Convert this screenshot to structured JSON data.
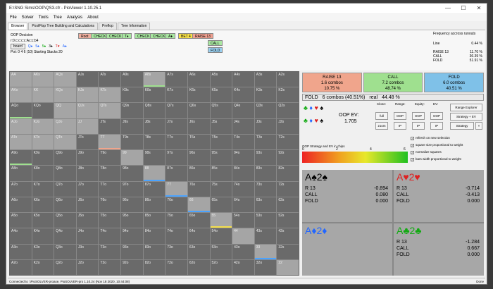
{
  "window": {
    "title": "E:\\SNG Sims\\OOP\\QS3.cfr - PioViewer 1.10.25.1",
    "min": "—",
    "max": "☐",
    "close": "✕"
  },
  "menu": [
    "File",
    "Solver",
    "Tools",
    "Tree",
    "Analysis",
    "About"
  ],
  "tabs": [
    "Browser",
    "PostFlop Tree Building and Calculations",
    "Preflop",
    "Tree Information"
  ],
  "oop": {
    "title": "OOP Decision",
    "hand_line": "r:0:c:c:c:c:Ac:c:b4",
    "board_btn": "board",
    "board": [
      "Q♠",
      "5♠",
      "5♠",
      "3♠",
      "T♥",
      "A♠"
    ],
    "pot_line": "Pot: 0 4 6 (10) Starting Stacks 20"
  },
  "tree": [
    {
      "label": "Root",
      "bg": "#f0b0a0"
    },
    {
      "label": "CHECK",
      "bg": "#a8e6a0"
    },
    {
      "label": "CHECK",
      "bg": "#a8e6a0"
    },
    {
      "label": "T♦",
      "bg": "#a8e6a0"
    },
    {
      "label": "CHECK",
      "bg": "#a8e6a0"
    },
    {
      "label": "CHECK",
      "bg": "#a8e6a0"
    },
    {
      "label": "A♦",
      "bg": "#a8e6a0"
    },
    {
      "label": "BET 4",
      "bg": "#f6e04a"
    },
    {
      "label": "RAISE 13",
      "bg": "#f0a090"
    },
    {
      "label": "CALL",
      "bg": "#a8e6a0"
    },
    {
      "label": "FOLD",
      "bg": "#9ad0f0"
    }
  ],
  "stats": {
    "title": "Frequency accross runouts",
    "line": "Line",
    "line_val": "0.44 %",
    "rows": [
      {
        "k": "RAISE 13",
        "v": "11.70 %"
      },
      {
        "k": "CALL",
        "v": "36.39 %"
      },
      {
        "k": "FOLD",
        "v": "51.91 %"
      }
    ]
  },
  "grid": {
    "rows": [
      [
        "AA",
        "AKs",
        "AQs",
        "AJs",
        "ATs",
        "A9s",
        "A8s",
        "A7s",
        "A6s",
        "A5s",
        "A4s",
        "A3s",
        "A2s"
      ],
      [
        "AKo",
        "KK",
        "KQs",
        "KJs",
        "KTs",
        "K9s",
        "K8s",
        "K7s",
        "K6s",
        "K5s",
        "K4s",
        "K3s",
        "K2s"
      ],
      [
        "AQo",
        "KQo",
        "QQ",
        "QJs",
        "QTs",
        "Q9s",
        "Q8s",
        "Q7s",
        "Q6s",
        "Q5s",
        "Q4s",
        "Q3s",
        "Q2s"
      ],
      [
        "AJo",
        "KJo",
        "QJo",
        "JJ",
        "JTs",
        "J9s",
        "J8s",
        "J7s",
        "J6s",
        "J5s",
        "J4s",
        "J3s",
        "J2s"
      ],
      [
        "ATo",
        "KTo",
        "QTo",
        "JTo",
        "TT",
        "T9s",
        "T8s",
        "T7s",
        "T6s",
        "T5s",
        "T4s",
        "T3s",
        "T2s"
      ],
      [
        "A9o",
        "K9o",
        "Q9o",
        "J9o",
        "T9o",
        "99",
        "98s",
        "97s",
        "96s",
        "95s",
        "94s",
        "93s",
        "92s"
      ],
      [
        "A8o",
        "K8o",
        "Q8o",
        "J8o",
        "T8o",
        "98o",
        "88",
        "87s",
        "86s",
        "85s",
        "84s",
        "83s",
        "82s"
      ],
      [
        "A7o",
        "K7o",
        "Q7o",
        "J7o",
        "T7o",
        "97o",
        "87o",
        "77",
        "76s",
        "75s",
        "74s",
        "73s",
        "72s"
      ],
      [
        "A6o",
        "K6o",
        "Q6o",
        "J6o",
        "T6o",
        "96o",
        "86o",
        "76o",
        "66",
        "65s",
        "64s",
        "63s",
        "62s"
      ],
      [
        "A5o",
        "K5o",
        "Q5o",
        "J5o",
        "T5o",
        "95o",
        "85o",
        "75o",
        "65o",
        "55",
        "54s",
        "53s",
        "52s"
      ],
      [
        "A4o",
        "K4o",
        "Q4o",
        "J4o",
        "T4o",
        "94o",
        "84o",
        "74o",
        "64o",
        "54o",
        "44",
        "43s",
        "42s"
      ],
      [
        "A3o",
        "K3o",
        "Q3o",
        "J3o",
        "T3o",
        "93o",
        "83o",
        "73o",
        "63o",
        "53o",
        "43o",
        "33",
        "32s"
      ],
      [
        "A2o",
        "K2o",
        "Q2o",
        "J2o",
        "T2o",
        "92o",
        "82o",
        "72o",
        "62o",
        "52o",
        "42o",
        "32o",
        "22"
      ]
    ]
  },
  "actions": [
    {
      "name": "RAISE 13",
      "combos": "1.6 combos",
      "pct": "10.75 %",
      "bg": "#f0a58c"
    },
    {
      "name": "CALL",
      "combos": "7.2 combos",
      "pct": "48.74 %",
      "bg": "#9fe08f"
    },
    {
      "name": "FOLD",
      "combos": "6.0 combos",
      "pct": "40.51 %",
      "bg": "#7fc1e8"
    }
  ],
  "summary": {
    "action": "FOLD",
    "combos": "6 combos (40.51%)",
    "real": "real",
    "real_val": "44.48 %"
  },
  "ev": {
    "label": "OOP EV:",
    "value": "1.705",
    "clone": "Clone:",
    "range": "Range:",
    "equity": "Equity:",
    "ev_lbl": "EV:",
    "range_explorer": "Range Explorer",
    "strategy_ev": "Strategy + EV",
    "strategy": "Strategy",
    "full": "full",
    "zoom": "zoom",
    "oop": "OOP",
    "ip": "IP"
  },
  "legend": {
    "title": "OOP Strategy and EV in chips",
    "ticks": [
      "0",
      "2",
      "4",
      "6"
    ]
  },
  "options": [
    {
      "label": "refresh on new selection",
      "checked": true
    },
    {
      "label": "square size proportional to weight",
      "checked": true
    },
    {
      "label": "normalize squares",
      "checked": true
    },
    {
      "label": "bars width proportional to weight",
      "checked": true
    }
  ],
  "suit_panels": [
    {
      "hand": "A♠2♠",
      "color": "blk",
      "rows": [
        {
          "k": "R 13",
          "v": "-0.894"
        },
        {
          "k": "CALL",
          "v": "0.080"
        },
        {
          "k": "FOLD",
          "v": "0.000"
        }
      ]
    },
    {
      "hand": "A♥2♥",
      "color": "red",
      "rows": [
        {
          "k": "R 13",
          "v": "-0.714"
        },
        {
          "k": "CALL",
          "v": "-0.413"
        },
        {
          "k": "FOLD",
          "v": "0.000"
        }
      ]
    },
    {
      "hand": "A♦2♦",
      "color": "blu",
      "rows": []
    },
    {
      "hand": "A♣2♣",
      "color": "grn",
      "rows": [
        {
          "k": "R 13",
          "v": "-1.284"
        },
        {
          "k": "CALL",
          "v": "0.667"
        },
        {
          "k": "FOLD",
          "v": "0.000"
        }
      ]
    }
  ],
  "status": {
    "left": "Connected to .\\PioSOLVER-proaxe, PioSOLVER-pro 1.10.24 (Nov 18 2020, 10:44:08)",
    "right": "Done"
  }
}
